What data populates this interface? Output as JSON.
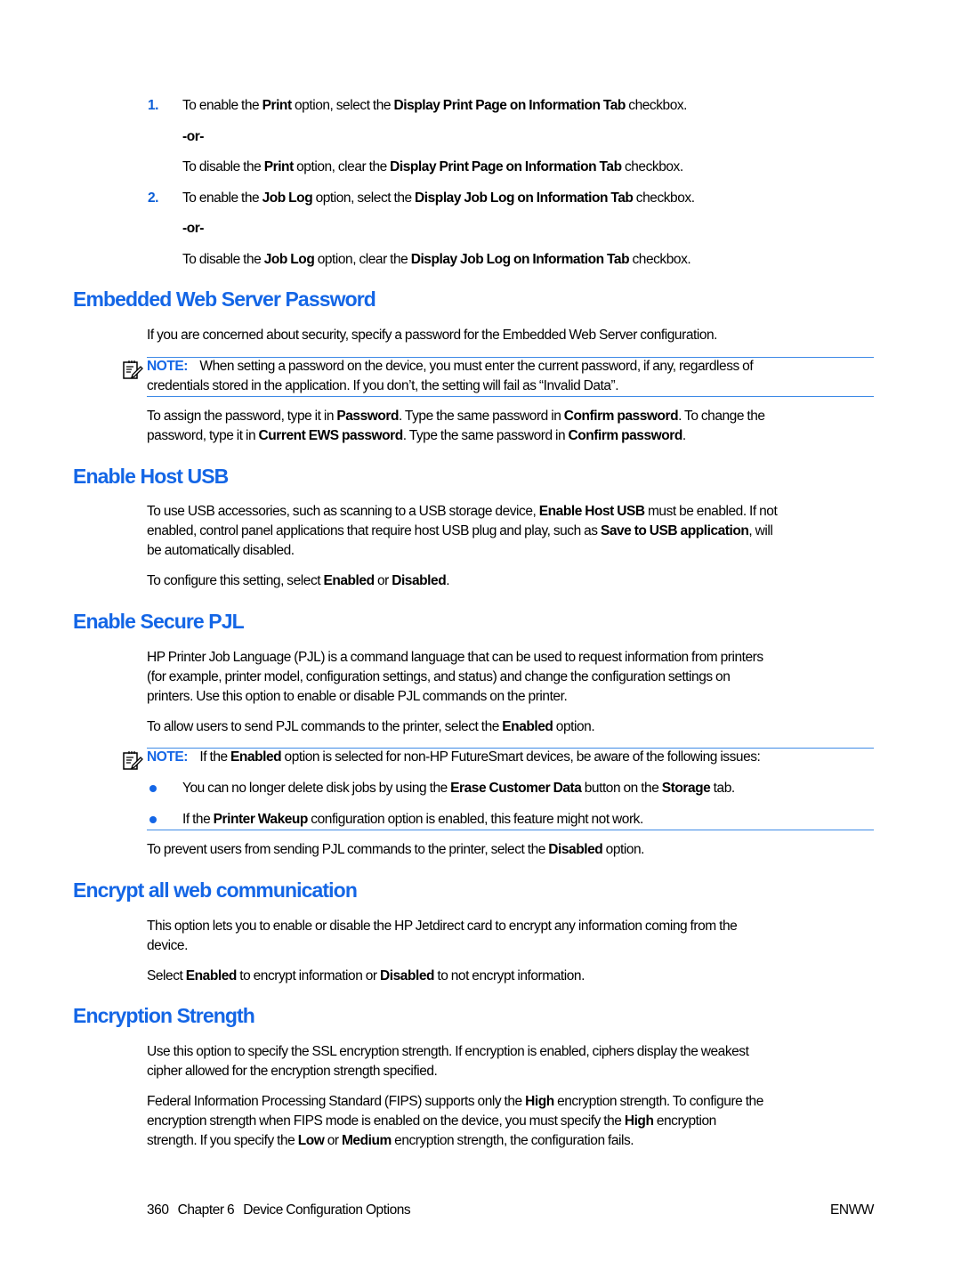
{
  "steps": [
    {
      "number": "1.",
      "enable": [
        "To enable the ",
        "Print",
        " option, select the ",
        "Display Print Page on Information Tab",
        " checkbox."
      ],
      "or": "-or-",
      "disable": [
        "To disable the ",
        "Print",
        " option, clear the ",
        "Display Print Page on Information Tab",
        " checkbox."
      ]
    },
    {
      "number": "2.",
      "enable": [
        "To enable the ",
        "Job Log",
        " option, select the ",
        "Display Job Log on Information Tab",
        " checkbox."
      ],
      "or": "-or-",
      "disable": [
        "To disable the ",
        "Job Log",
        " option, clear the ",
        "Display Job Log on Information Tab",
        " checkbox."
      ]
    }
  ],
  "sections": {
    "ews_password": {
      "heading": "Embedded Web Server Password",
      "intro": "If you are concerned about security, specify a password for the Embedded Web Server configuration.",
      "note_label": "NOTE:",
      "note_line1": "When setting a password on the device, you must enter the current password, if any, regardless of",
      "note_line2": "credentials stored in the application. If you don’t, the setting will fail as “Invalid Data”.",
      "assign_line1": [
        "To assign the password, type it in ",
        "Password",
        ". Type the same password in ",
        "Confirm password",
        ". To change the"
      ],
      "assign_line2": [
        "password, type it in ",
        "Current EWS password",
        ". Type the same password in ",
        "Confirm password",
        "."
      ]
    },
    "host_usb": {
      "heading": "Enable Host USB",
      "line1": [
        "To use USB accessories, such as scanning to a USB storage device, ",
        "Enable Host USB",
        " must be enabled. If not"
      ],
      "line2": [
        "enabled, control panel applications that require host USB plug and play, such as ",
        "Save to USB application",
        ", will"
      ],
      "line3": "be automatically disabled.",
      "configure": [
        "To configure this setting, select ",
        "Enabled",
        " or ",
        "Disabled",
        "."
      ]
    },
    "secure_pjl": {
      "heading": "Enable Secure PJL",
      "line1": "HP Printer Job Language (PJL) is a command language that can be used to request information from printers",
      "line2": "(for example, printer model, configuration settings, and status) and change the configuration settings on",
      "line3": "printers. Use this option to enable or disable PJL commands on the printer.",
      "allow": [
        "To allow users to send PJL commands to the printer, select the ",
        "Enabled",
        " option."
      ],
      "note_label": "NOTE:",
      "note_text": [
        "If the ",
        "Enabled",
        " option is selected for non-HP FutureSmart devices, be aware of the following issues:"
      ],
      "bullets": [
        [
          "You can no longer delete disk jobs by using the ",
          "Erase Customer Data",
          " button on the ",
          "Storage",
          " tab."
        ],
        [
          "If the ",
          "Printer Wakeup",
          " configuration option is enabled, this feature might not work."
        ]
      ],
      "prevent": [
        "To prevent users from sending PJL commands to the printer, select the ",
        "Disabled",
        " option."
      ]
    },
    "encrypt_web": {
      "heading": "Encrypt all web communication",
      "line1": "This option lets you to enable or disable the HP Jetdirect card to encrypt any information coming from the",
      "line2": "device.",
      "select": [
        "Select ",
        "Enabled",
        " to encrypt information or ",
        "Disabled",
        " to not encrypt information."
      ]
    },
    "encryption_strength": {
      "heading": "Encryption Strength",
      "line1": "Use this option to specify the SSL encryption strength. If encryption is enabled, ciphers display the weakest",
      "line2": "cipher allowed for the encryption strength specified.",
      "fips_line1": [
        "Federal Information Processing Standard (FIPS) supports only the ",
        "High",
        " encryption strength. To configure the"
      ],
      "fips_line2": [
        "encryption strength when FIPS mode is enabled on the device, you must specify the ",
        "High",
        " encryption"
      ],
      "fips_line3": [
        "strength. If you specify the ",
        "Low",
        " or ",
        "Medium",
        " encryption strength, the configuration fails."
      ]
    }
  },
  "footer": {
    "page_number": "360",
    "chapter": "Chapter 6",
    "chapter_title": "Device Configuration Options",
    "locale": "ENWW"
  },
  "colors": {
    "heading": "#1466e6",
    "note_rule": "#3e8ae6",
    "bullet": "#1466e6",
    "text": "#000000"
  }
}
